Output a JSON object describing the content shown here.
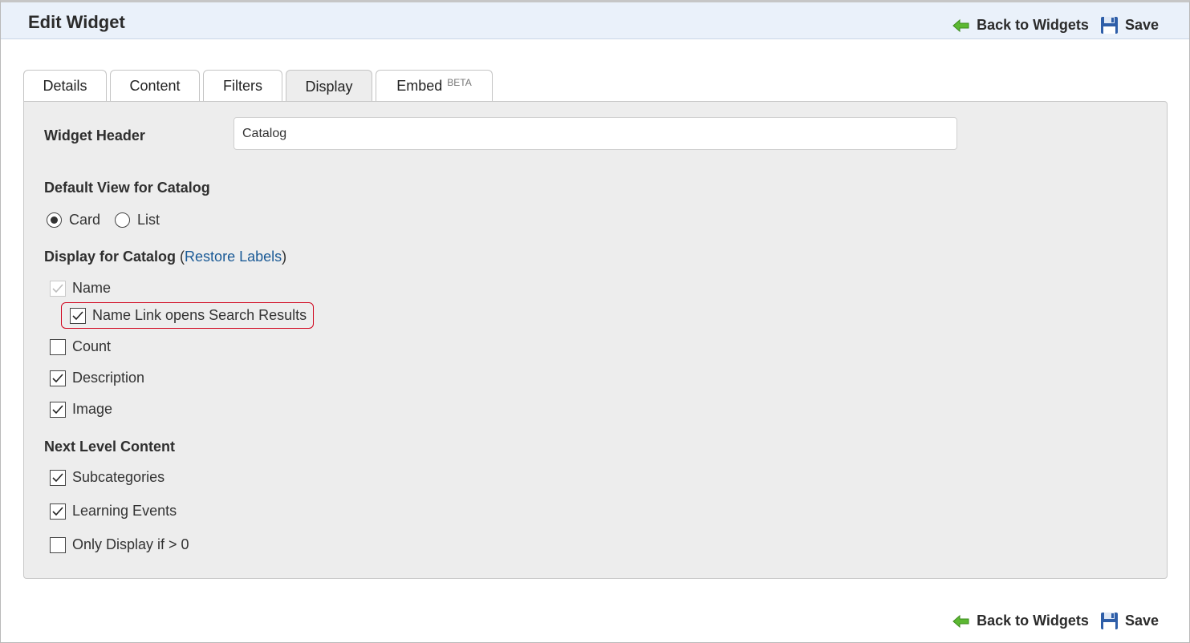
{
  "header": {
    "title": "Edit Widget",
    "back_label": "Back to Widgets",
    "save_label": "Save"
  },
  "tabs": [
    {
      "label": "Details",
      "active": false
    },
    {
      "label": "Content",
      "active": false
    },
    {
      "label": "Filters",
      "active": false
    },
    {
      "label": "Display",
      "active": true
    },
    {
      "label": "Embed",
      "badge": "BETA",
      "active": false
    }
  ],
  "widget_header": {
    "label": "Widget Header",
    "value": "Catalog"
  },
  "default_view": {
    "label": "Default View for Catalog",
    "options": [
      {
        "label": "Card",
        "selected": true
      },
      {
        "label": "List",
        "selected": false
      }
    ]
  },
  "display_for": {
    "label": "Display for Catalog",
    "restore_link": "Restore Labels",
    "open_paren": "(",
    "close_paren": ")",
    "items": [
      {
        "label": "Name",
        "checked": true,
        "disabled": true
      },
      {
        "label": "Name Link opens Search Results",
        "checked": true
      },
      {
        "label": "Count",
        "checked": false
      },
      {
        "label": "Description",
        "checked": true
      },
      {
        "label": "Image",
        "checked": true
      }
    ]
  },
  "next_level": {
    "label": "Next Level Content",
    "items": [
      {
        "label": "Subcategories",
        "checked": true
      },
      {
        "label": "Learning Events",
        "checked": true
      },
      {
        "label": "Only Display if > 0",
        "checked": false
      }
    ]
  },
  "icons": {
    "back": "green-arrow-left-icon",
    "save": "floppy-disk-icon",
    "check": "checkmark-icon"
  },
  "colors": {
    "titlebar_bg": "#eaf1fa",
    "panel_bg": "#ededed",
    "link": "#1a5a96",
    "highlight_border": "#d0021b",
    "arrow_green": "#5cb832",
    "save_blue": "#2e5ea8"
  }
}
